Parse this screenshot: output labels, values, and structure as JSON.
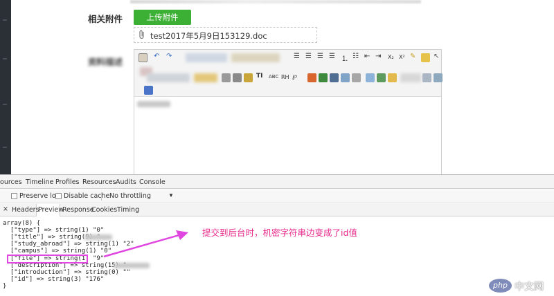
{
  "form": {
    "attachment_label": "相关附件",
    "upload_button": "上传附件",
    "file_name": "test2017年5月9日153129.doc",
    "description_label": "资料描述"
  },
  "devtools": {
    "main_tabs": [
      "Sources",
      "Timeline",
      "Profiles",
      "Resources",
      "Audits",
      "Console"
    ],
    "filter": {
      "preserve_log": "Preserve log",
      "disable_cache": "Disable cache",
      "throttling": "No throttling"
    },
    "sub_tabs": [
      "Headers",
      "Preview",
      "Response",
      "Cookies",
      "Timing"
    ],
    "active_sub_tab": "Preview",
    "output_lines": [
      "array(8) {",
      "  [\"type\"] => string(1) \"0\"",
      "  [\"title\"] => string(9) \"",
      "  [\"study_abroad\"] => string(1) \"2\"",
      "  [\"campus\"] => string(1) \"0\"",
      "  [\"file\"] => string(1) \"9\"",
      "  [\"description\"] => string(15) \"",
      "  [\"introduction\"] => string(0) \"\"",
      "  [\"id\"] => string(3) \"176\"",
      "}"
    ]
  },
  "annotation": {
    "text": "提交到后台时，机密字符串边变成了id值",
    "color": "#e8288c",
    "highlight_color": "#e046e0"
  },
  "watermark": {
    "logo": "php",
    "text": "中文网"
  },
  "colors": {
    "upload_button": "#3cb035",
    "sidebar": "#2b2f36"
  }
}
